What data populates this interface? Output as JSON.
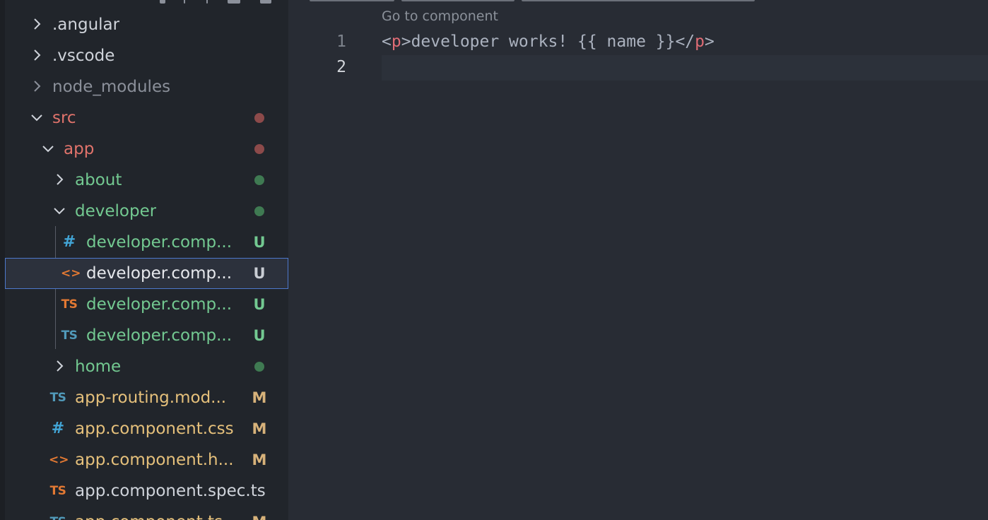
{
  "colors": {
    "folder_default": "#cfd3da",
    "folder_dim": "#8b909a",
    "modified_red": "#e0736b",
    "untracked_green": "#73c991",
    "modified_yellow": "#e5c07b",
    "dot_red": "#8c4a4a",
    "dot_green": "#3f7a52",
    "badge_u": "#73c991",
    "badge_m": "#d7b27a",
    "icon_css": "#42a5d6",
    "icon_html": "#e37933",
    "icon_ts_orange": "#e37933",
    "icon_ts_blue": "#519aba"
  },
  "explorer": {
    "items": [
      {
        "label": ".angular"
      },
      {
        "label": ".vscode"
      },
      {
        "label": "node_modules"
      },
      {
        "label": "src"
      },
      {
        "label": "app"
      },
      {
        "label": "about"
      },
      {
        "label": "developer"
      },
      {
        "label": "developer.comp...",
        "icon": "css-icon",
        "glyph": "#",
        "badge": "U"
      },
      {
        "label": "developer.comp...",
        "icon": "html-icon",
        "glyph": "<>",
        "badge": "U"
      },
      {
        "label": "developer.comp...",
        "icon": "ts-icon",
        "glyph": "TS",
        "badge": "U"
      },
      {
        "label": "developer.comp...",
        "icon": "ts-icon",
        "glyph": "TS",
        "badge": "U"
      },
      {
        "label": "home"
      },
      {
        "label": "app-routing.mod...",
        "icon": "ts-icon",
        "glyph": "TS",
        "badge": "M"
      },
      {
        "label": "app.component.css",
        "icon": "css-icon",
        "glyph": "#",
        "badge": "M"
      },
      {
        "label": "app.component.h...",
        "icon": "html-icon",
        "glyph": "<>",
        "badge": "M"
      },
      {
        "label": "app.component.spec.ts",
        "icon": "ts-icon",
        "glyph": "TS"
      },
      {
        "label": "app.component.ts",
        "icon": "ts-icon",
        "glyph": "TS",
        "badge": "M"
      }
    ]
  },
  "editor": {
    "codelens": "Go to component",
    "lines": [
      {
        "number": "1",
        "open_lt": "<",
        "open_tag": "p",
        "open_gt": ">",
        "text": "developer works! {{ name }}",
        "close_lt": "</",
        "close_tag": "p",
        "close_gt": ">"
      },
      {
        "number": "2"
      }
    ]
  }
}
